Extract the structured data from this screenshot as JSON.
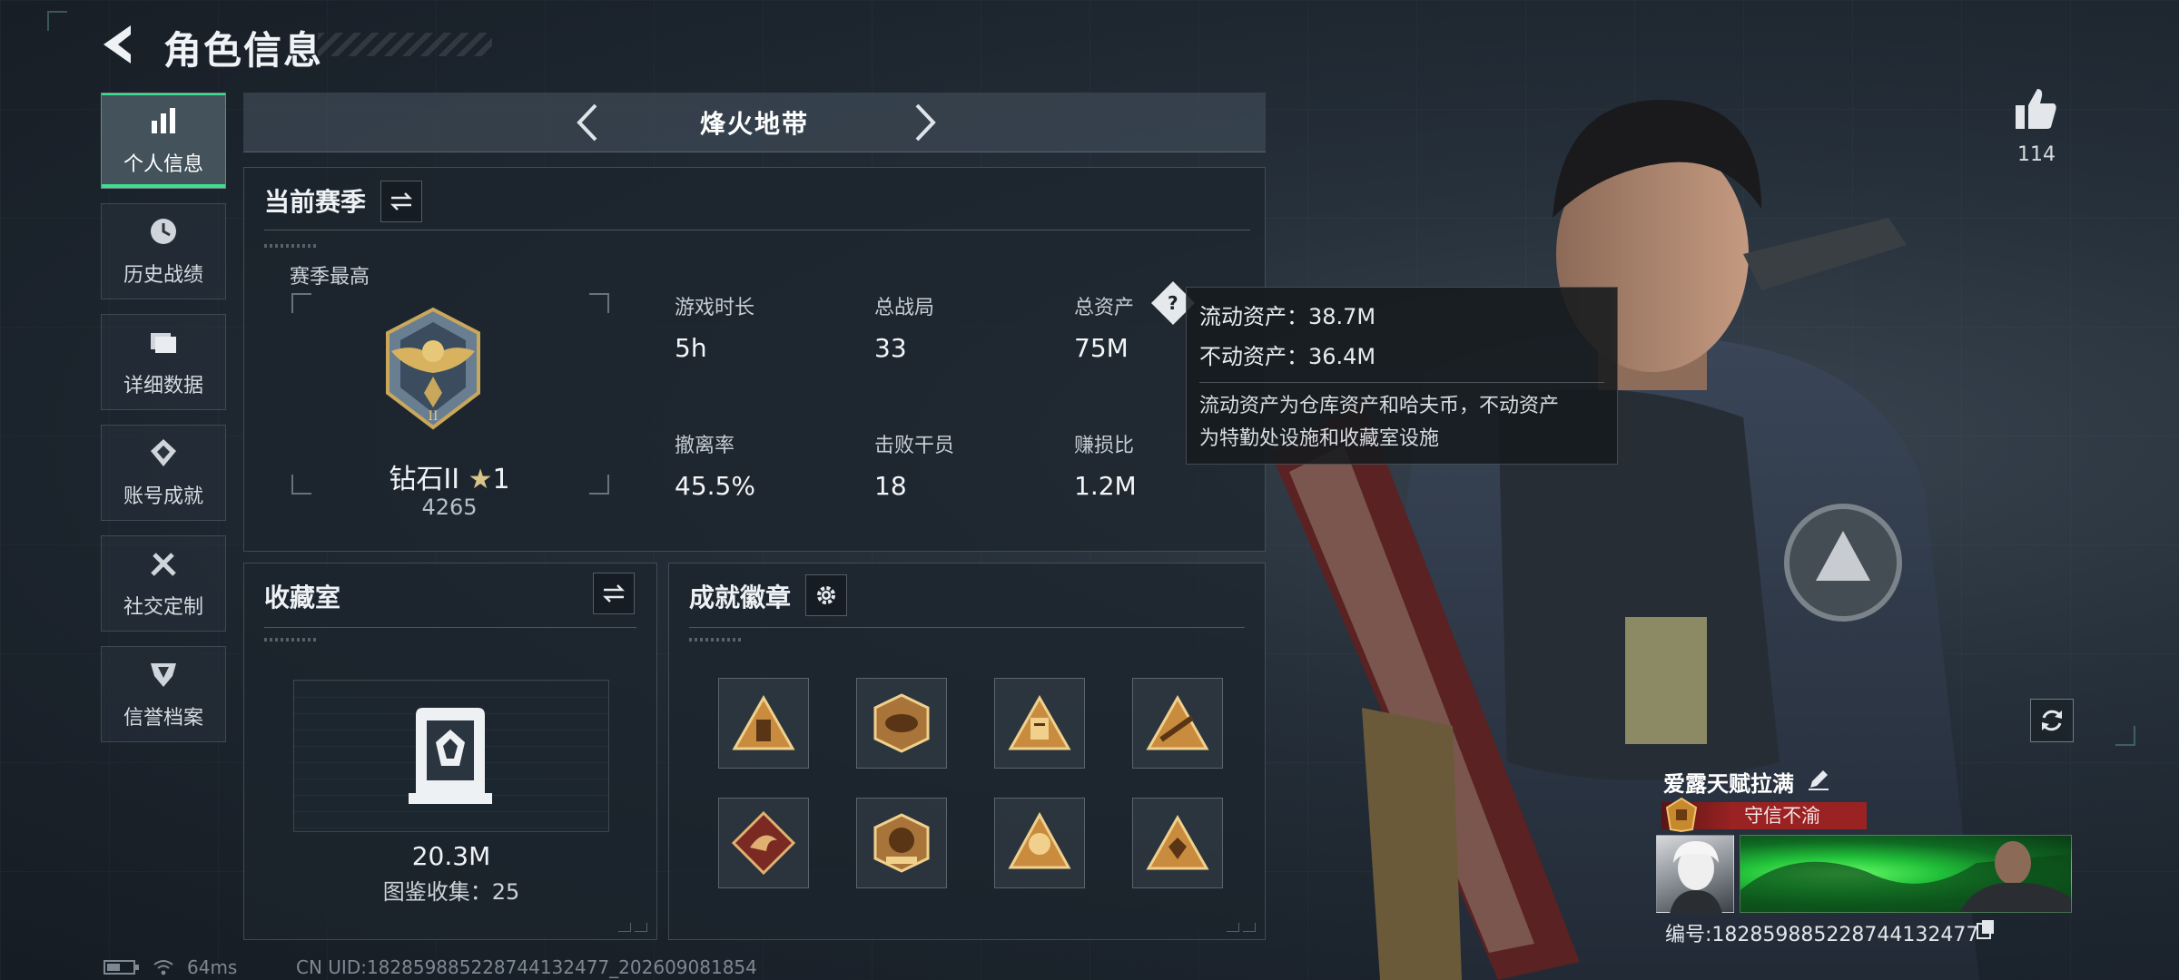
{
  "header": {
    "title": "角色信息"
  },
  "nav": {
    "items": [
      {
        "label": "个人信息",
        "icon": "bar-chart-icon",
        "active": true
      },
      {
        "label": "历史战绩",
        "icon": "history-clock-icon",
        "active": false
      },
      {
        "label": "详细数据",
        "icon": "folder-icon",
        "active": false
      },
      {
        "label": "账号成就",
        "icon": "achievement-icon",
        "active": false
      },
      {
        "label": "社交定制",
        "icon": "tools-icon",
        "active": false
      },
      {
        "label": "信誉档案",
        "icon": "credit-shield-icon",
        "active": false
      }
    ]
  },
  "mode": {
    "title": "烽火地带"
  },
  "season": {
    "title": "当前赛季",
    "best_label": "赛季最高",
    "rank_name": "钻石II",
    "rank_stars": "1",
    "rank_score": "4265",
    "stats": [
      {
        "label": "游戏时长",
        "value": "5h"
      },
      {
        "label": "总战局",
        "value": "33"
      },
      {
        "label": "总资产",
        "value": "75M"
      },
      {
        "label": "撤离率",
        "value": "45.5%"
      },
      {
        "label": "击败干员",
        "value": "18"
      },
      {
        "label": "赚损比",
        "value": "1.2M"
      }
    ]
  },
  "tooltip": {
    "liquid": "流动资产：38.7M",
    "fixed": "不动资产：36.4M",
    "desc_line1": "流动资产为仓库资产和哈夫币，不动资产",
    "desc_line2": "为特勤处设施和收藏室设施"
  },
  "collection": {
    "title": "收藏室",
    "value": "20.3M",
    "count_text": "图鉴收集：25"
  },
  "badges": {
    "title": "成就徽章",
    "items": [
      "badge-1",
      "badge-2",
      "badge-3",
      "badge-4",
      "badge-5",
      "badge-6",
      "badge-7",
      "badge-8"
    ]
  },
  "profile": {
    "likes": "114",
    "player_name": "爱露天赋拉满",
    "title_text": "守信不渝",
    "player_id": "编号:182859885228744132477"
  },
  "status": {
    "ping": "64ms",
    "uid": "CN UID:182859885228744132477_202609081854"
  },
  "colors": {
    "accent_green": "#3ee08e",
    "title_red": "#9a2222",
    "gold": "#d9c58a"
  }
}
